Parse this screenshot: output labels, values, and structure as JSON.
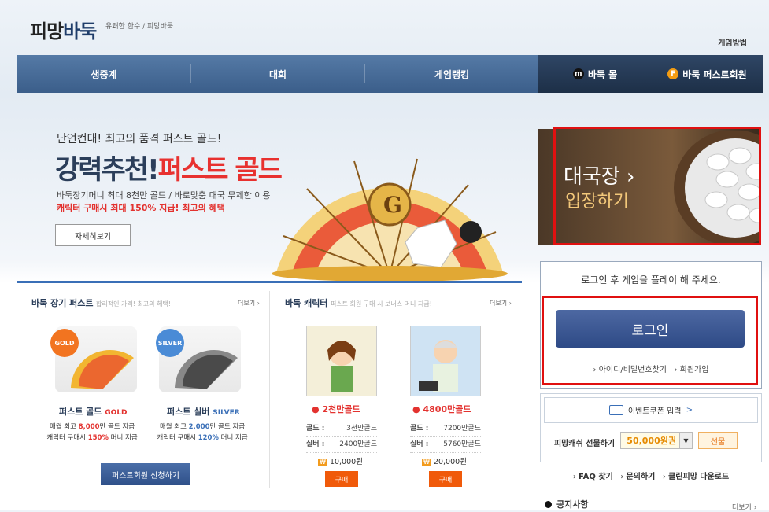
{
  "header": {
    "logo_main": "피망",
    "logo_accent": "바둑",
    "tagline": "유쾌한 한수 / 피망바둑",
    "how_to": "게임방법"
  },
  "nav": {
    "items": [
      {
        "label": "생중계"
      },
      {
        "label": "대회"
      },
      {
        "label": "게임랭킹"
      },
      {
        "label": "바둑 몰"
      },
      {
        "label": "바둑 퍼스트회원"
      }
    ]
  },
  "banner": {
    "subtitle": "단언컨대! 최고의 품격 퍼스트 골드!",
    "title_1": "강력추천!",
    "title_2": "퍼스트 골드",
    "desc_1": "바둑장기머니 최대 8천만 골드 / 바로맞춤 대국 무제한 이용",
    "desc_2": "캐릭터 구매시 최대 150% 지급! 최고의 혜택",
    "button": "자세히보기"
  },
  "hall": {
    "line1": "대국장",
    "arrow": "›",
    "line2": "입장하기"
  },
  "login": {
    "message": "로그인 후 게임을 플레이 해 주세요.",
    "button": "로그인",
    "find": "아이디/비밀번호찾기",
    "join": "회원가입"
  },
  "coupon": {
    "label": "이벤트쿠폰 입력",
    "arrow": ">"
  },
  "gift": {
    "label": "피망캐쉬 선물하기",
    "value": "50,000원권",
    "button": "선물"
  },
  "links": {
    "faq": "FAQ 찾기",
    "inquiry": "문의하기",
    "clean": "클린피망 다운로드"
  },
  "notice": {
    "title": "공지사항",
    "more": "더보기 ›"
  },
  "first": {
    "title": "바둑 장기 퍼스트",
    "sub": "합리적인 가격! 최고의 혜택!",
    "more": "더보기 ›",
    "gold_badge": "GOLD",
    "silver_badge": "SILVER",
    "gold_name": "퍼스트 골드",
    "gold_tag": "GOLD",
    "silver_name": "퍼스트 실버",
    "silver_tag": "SILVER",
    "gold_desc_1a": "매월 최고 ",
    "gold_desc_1b": "8,000",
    "gold_desc_1c": "만 골드 지급",
    "gold_desc_2a": "캐릭터 구매시 ",
    "gold_desc_2b": "150%",
    "gold_desc_2c": " 머니 지급",
    "silver_desc_1a": "매월 최고 ",
    "silver_desc_1b": "2,000",
    "silver_desc_1c": "만 골드 지급",
    "silver_desc_2a": "캐릭터 구매시 ",
    "silver_desc_2b": "120%",
    "silver_desc_2c": " 머니 지급",
    "apply": "퍼스트회원 신청하기"
  },
  "chars": {
    "title": "바둑 캐릭터",
    "sub": "퍼스트 회원 구매 시 보너스 머니 지급!",
    "more": "더보기 ›",
    "items": [
      {
        "name": "2천만골드",
        "gold_label": "골드 :",
        "gold": "3천만골드",
        "silver_label": "실버 :",
        "silver": "2400만골드",
        "price": "10,000원",
        "buy": "구매"
      },
      {
        "name": "4800만골드",
        "gold_label": "골드 :",
        "gold": "7200만골드",
        "silver_label": "실버 :",
        "silver": "5760만골드",
        "price": "20,000원",
        "buy": "구매"
      }
    ]
  }
}
